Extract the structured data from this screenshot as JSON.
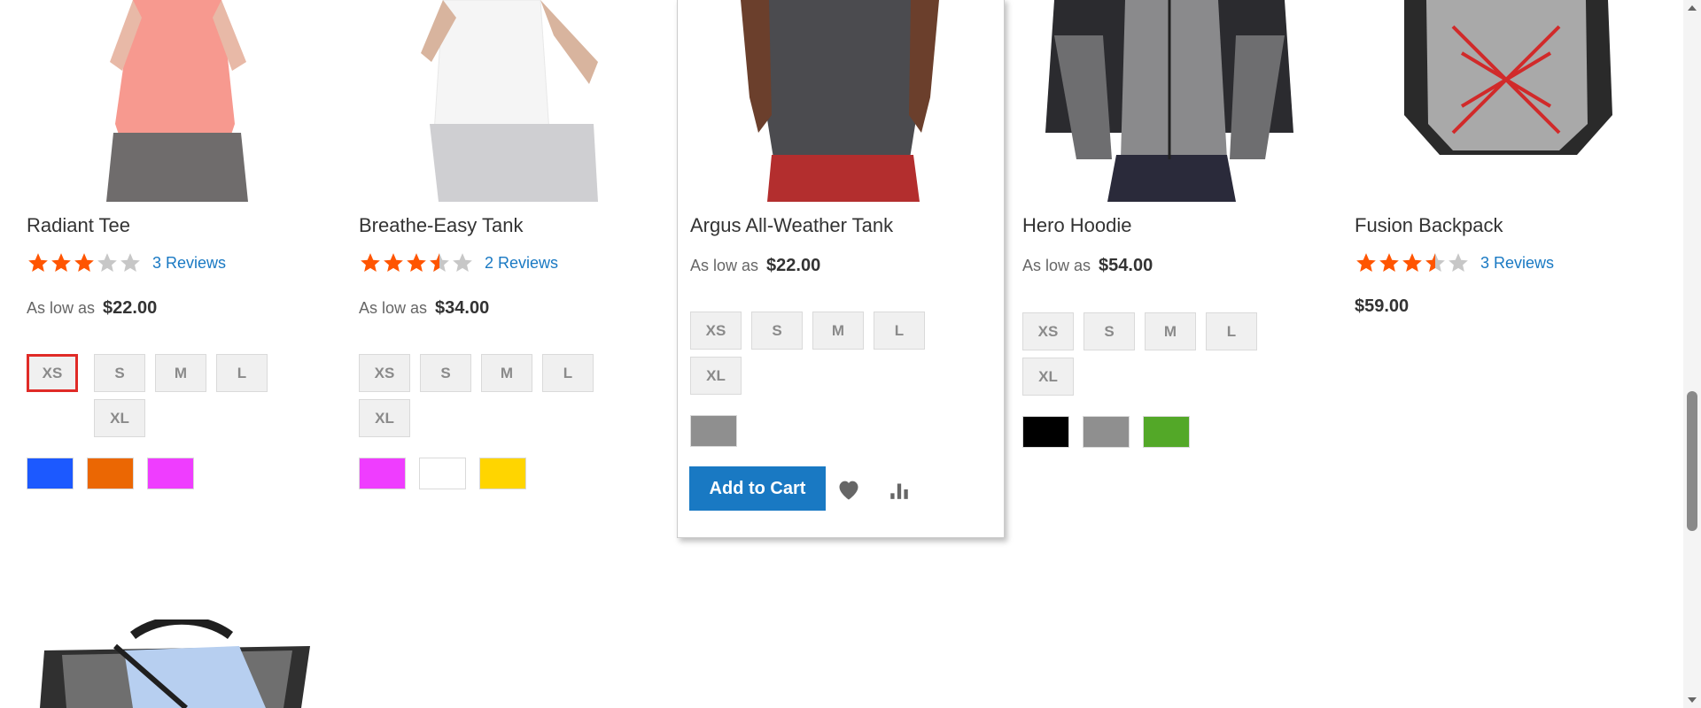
{
  "products": [
    {
      "name": "Radiant Tee",
      "rating_stars": 3,
      "reviews": "3 Reviews",
      "price_prefix": "As low as",
      "price": "$22.00",
      "sizes": [
        "XS",
        "S",
        "M",
        "L",
        "XL"
      ],
      "selected_size": "XS",
      "colors": [
        "#1c59ff",
        "#eb6703",
        "#ef3dff"
      ]
    },
    {
      "name": "Breathe-Easy Tank",
      "rating_stars": 3.5,
      "reviews": "2 Reviews",
      "price_prefix": "As low as",
      "price": "$34.00",
      "sizes": [
        "XS",
        "S",
        "M",
        "L",
        "XL"
      ],
      "colors": [
        "#ef3dff",
        "#ffffff",
        "#ffd500"
      ]
    },
    {
      "name": "Argus All-Weather Tank",
      "price_prefix": "As low as",
      "price": "$22.00",
      "sizes": [
        "XS",
        "S",
        "M",
        "L",
        "XL"
      ],
      "colors": [
        "#8f8f8f"
      ],
      "actions": {
        "add_to_cart": "Add to Cart",
        "wishlist_icon": "heart-icon",
        "compare_icon": "bar-chart-icon"
      }
    },
    {
      "name": "Hero Hoodie",
      "price_prefix": "As low as",
      "price": "$54.00",
      "sizes": [
        "XS",
        "S",
        "M",
        "L",
        "XL"
      ],
      "colors": [
        "#000000",
        "#8f8f8f",
        "#53a828"
      ]
    },
    {
      "name": "Fusion Backpack",
      "rating_stars": 3.5,
      "reviews": "3 Reviews",
      "price": "$59.00"
    }
  ],
  "theme": {
    "star_on": "#ff5501",
    "star_off": "#c7c7c7",
    "link": "#1979c3",
    "selected_border": "#e02b27"
  }
}
